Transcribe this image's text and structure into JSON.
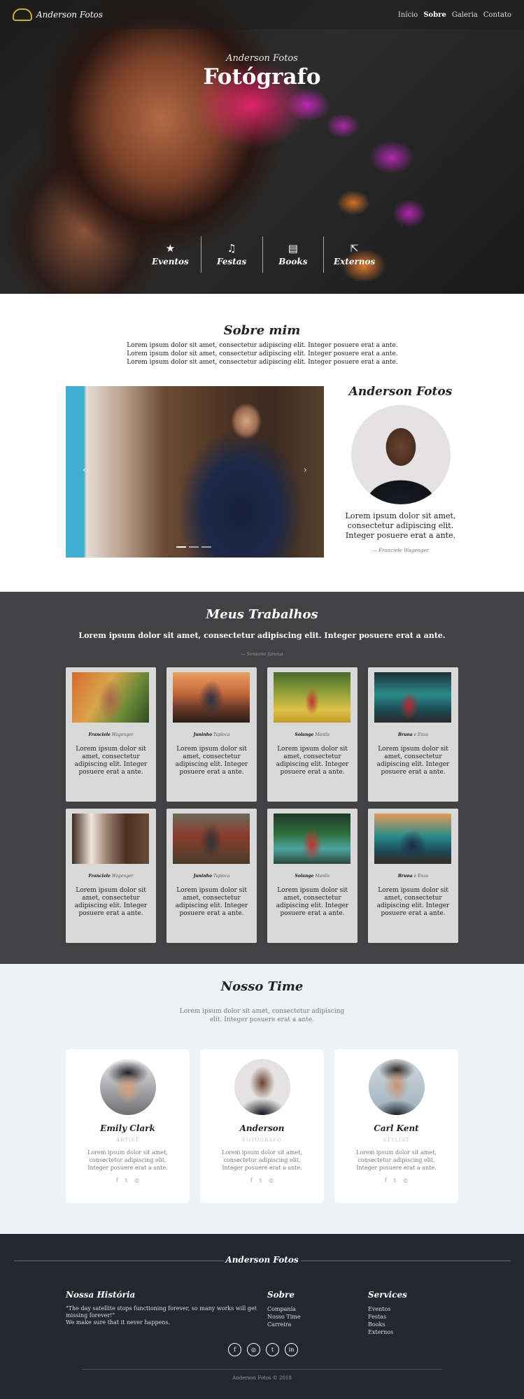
{
  "nav": {
    "logo_text": "Anderson Fotos",
    "links": [
      {
        "label": "Início"
      },
      {
        "label": "Sobre"
      },
      {
        "label": "Galeria"
      },
      {
        "label": "Contato"
      }
    ]
  },
  "hero": {
    "subtitle": "Anderson Fotos",
    "title": "Fotógrafo",
    "services": [
      {
        "label": "Eventos",
        "icon": "star-icon"
      },
      {
        "label": "Festas",
        "icon": "music-icon"
      },
      {
        "label": "Books",
        "icon": "book-icon"
      },
      {
        "label": "Externos",
        "icon": "external-link-icon"
      }
    ]
  },
  "about": {
    "title": "Sobre mim",
    "text": "Lorem ipsum dolor sit amet, consectetur adipiscing elit. Integer posuere erat a ante. Lorem ipsum dolor sit amet, consectetur adipiscing elit. Integer posuere erat a ante. Lorem ipsum dolor sit amet, consectetur adipiscing elit. Integer posuere erat a ante.",
    "carousel": {
      "prev": "‹",
      "next": "›",
      "indicator_count": 3,
      "active_index": 0
    },
    "profile": {
      "name": "Anderson Fotos",
      "quote": "Lorem ipsum dolor sit amet, consectetur adipiscing elit. Integer posuere erat a ante.",
      "cite": "— Franciele Wagenger"
    }
  },
  "works": {
    "title": "Meus Trabalhos",
    "lead": "Lorem ipsum dolor sit amet, consectetur adipiscing elit. Integer posuere erat a ante.",
    "cite": "— Someone famous",
    "cards": [
      {
        "first": "Franciele",
        "last": "Wagenger",
        "text": "Lorem ipsum dolor sit amet, consectetur adipiscing elit. Integer posuere erat a ante."
      },
      {
        "first": "Juninho",
        "last": "Tapioca",
        "text": "Lorem ipsum dolor sit amet, consectetur adipiscing elit. Integer posuere erat a ante."
      },
      {
        "first": "Solange",
        "last": "Mantiz",
        "text": "Lorem ipsum dolor sit amet, consectetur adipiscing elit. Integer posuere erat a ante."
      },
      {
        "first": "Bruna",
        "last": "e Enzo",
        "text": "Lorem ipsum dolor sit amet, consectetur adipiscing elit. Integer posuere erat a ante."
      },
      {
        "first": "Franciele",
        "last": "Wagenger",
        "text": "Lorem ipsum dolor sit amet, consectetur adipiscing elit. Integer posuere erat a ante."
      },
      {
        "first": "Juninho",
        "last": "Tapioca",
        "text": "Lorem ipsum dolor sit amet, consectetur adipiscing elit. Integer posuere erat a ante."
      },
      {
        "first": "Solange",
        "last": "Mantiz",
        "text": "Lorem ipsum dolor sit amet, consectetur adipiscing elit. Integer posuere erat a ante."
      },
      {
        "first": "Bruna",
        "last": "e Enzo",
        "text": "Lorem ipsum dolor sit amet, consectetur adipiscing elit. Integer posuere erat a ante."
      }
    ]
  },
  "team": {
    "title": "Nosso Time",
    "lead": "Lorem ipsum dolor sit amet, consectetur adipiscing elit. Integer posuere erat a ante.",
    "members": [
      {
        "name": "Emily Clark",
        "role": "ARTIST",
        "bio": "Lorem ipsum dolor sit amet, consectetur adipiscing elit. Integer posuere erat a ante."
      },
      {
        "name": "Anderson",
        "role": "FOTÓGRAFO",
        "bio": "Lorem ipsum dolor sit amet, consectetur adipiscing elit. Integer posuere erat a ante."
      },
      {
        "name": "Carl Kent",
        "role": "STYLIST",
        "bio": "Lorem ipsum dolor sit amet, consectetur adipiscing elit. Integer posuere erat a ante."
      }
    ],
    "social_icons": [
      "facebook-icon",
      "twitter-icon",
      "instagram-icon"
    ]
  },
  "footer": {
    "brand": "Anderson Fotos",
    "history": {
      "title": "Nossa História",
      "quote": "\"The day satellite stops functioning forever, so many works will get missing forever!\"",
      "note": "We make sure that it never happens."
    },
    "sobre": {
      "title": "Sobre",
      "links": [
        "Companía",
        "Nosso Time",
        "Carreira"
      ]
    },
    "services": {
      "title": "Services",
      "links": [
        "Eventos",
        "Festas",
        "Books",
        "Externos"
      ]
    },
    "social_icons": [
      "facebook-icon",
      "instagram-icon",
      "twitter-icon",
      "linkedin-icon"
    ],
    "copyright": "Anderson Fotos © 2018"
  },
  "colors": {
    "works_bg": "#424143",
    "team_bg": "#edf1f8",
    "footer_bg": "#232830"
  }
}
